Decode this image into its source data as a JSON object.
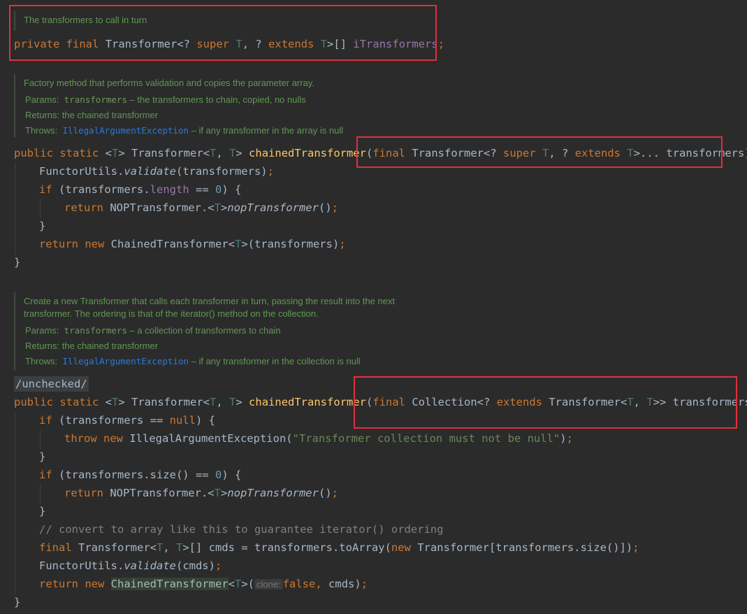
{
  "field_doc": "The transformers to call in turn",
  "field_decl": {
    "private": "private",
    "final": "final",
    "type": "Transformer",
    "generic_open": "<? ",
    "super": "super",
    "t1": "T",
    "sep": ", ? ",
    "extends": "extends",
    "t2": "T",
    "generic_close": ">[] ",
    "name": "iTransformers",
    "semi": ";"
  },
  "method1_doc": {
    "desc": "Factory method that performs validation and copies the parameter array.",
    "params_label": "Params:",
    "params_name": "transformers",
    "params_text": " – the transformers to chain, copied, no nulls",
    "returns_label": "Returns:",
    "returns_text": "the chained transformer",
    "throws_label": "Throws:",
    "throws_name": "IllegalArgumentException",
    "throws_text": " – if any transformer in the array is null"
  },
  "method2_doc": {
    "desc_line1": "Create a new Transformer that calls each transformer in turn, passing the result into the next",
    "desc_line2": "transformer. The ordering is that of the iterator() method on the collection.",
    "params_label": "Params:",
    "params_name": "transformers",
    "params_text": " – a collection of transformers to chain",
    "returns_label": "Returns:",
    "returns_text": "the chained transformer",
    "throws_label": "Throws:",
    "throws_name": "IllegalArgumentException",
    "throws_text": " – if any transformer in the collection is null"
  },
  "annotation": "/unchecked/",
  "comment": "// convert to array like this to guarantee iterator() ordering",
  "string_literal": "\"Transformer collection must not be null\"",
  "param_hint": "clone:"
}
